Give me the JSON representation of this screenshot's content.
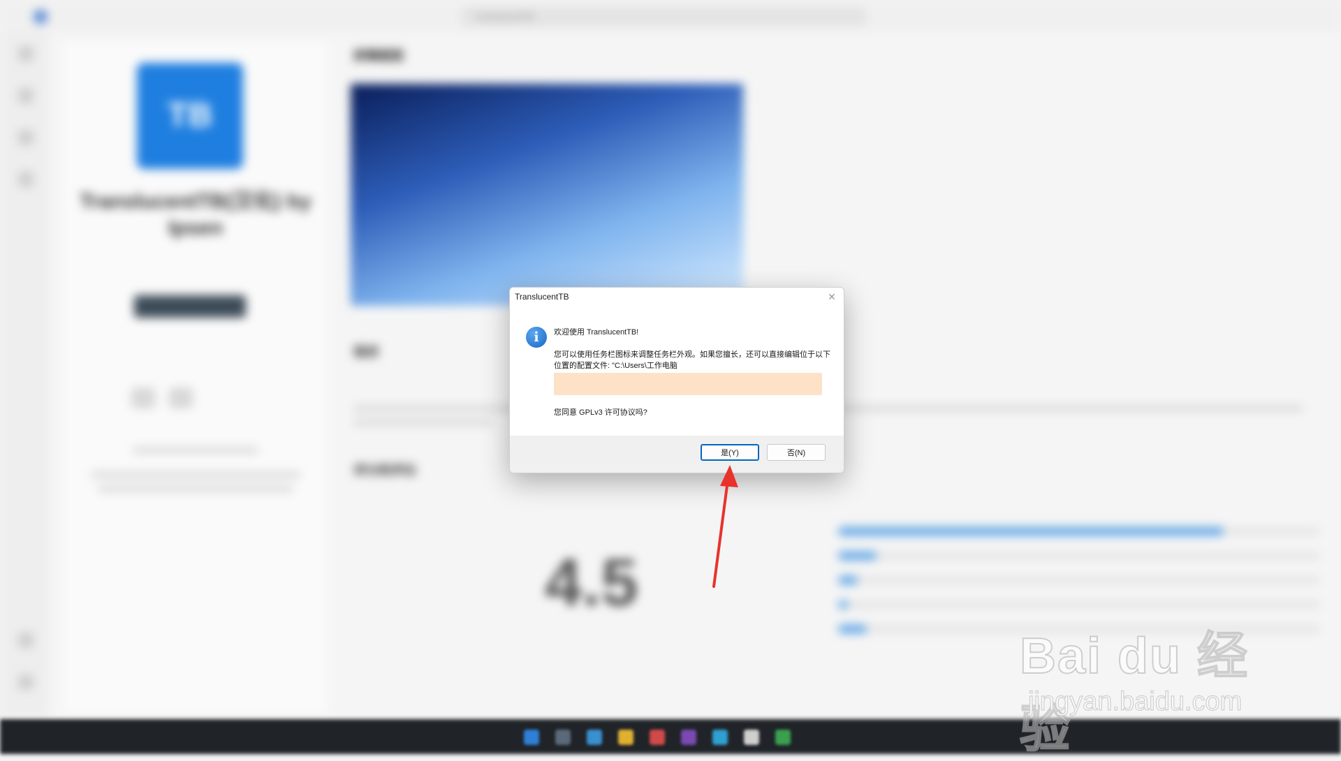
{
  "background": {
    "window_title": "TranslucentTB",
    "app_tile_text": "TB",
    "app_name": "TranslucentTB(汉化) by Ipsen",
    "launch_label": "启动",
    "screenshots_title": "屏幕截图",
    "description_title": "描述",
    "ratings_title": "评分和评论",
    "rating_value": "4.5",
    "rating_bars": [
      0.8,
      0.08,
      0.04,
      0.02,
      0.06
    ]
  },
  "dialog": {
    "title": "TranslucentTB",
    "close_glyph": "✕",
    "icon_glyph": "i",
    "welcome": "欢迎使用 TranslucentTB!",
    "body": "您可以使用任务栏图标来调整任务栏外观。如果您擅长，还可以直接编辑位于以下位置的配置文件: \"C:\\Users\\工作电脑",
    "question": "您同意 GPLv3 许可协议吗?",
    "yes_label": "是(Y)",
    "no_label": "否(N)"
  },
  "annotation": {
    "arrow_color": "#e8322b"
  },
  "watermark": {
    "logo": "Bai du 经验",
    "url": "jingyan.baidu.com"
  },
  "colors": {
    "accent": "#0067c0",
    "info_icon": "#1a73d1",
    "redaction": "#fde2c8"
  }
}
